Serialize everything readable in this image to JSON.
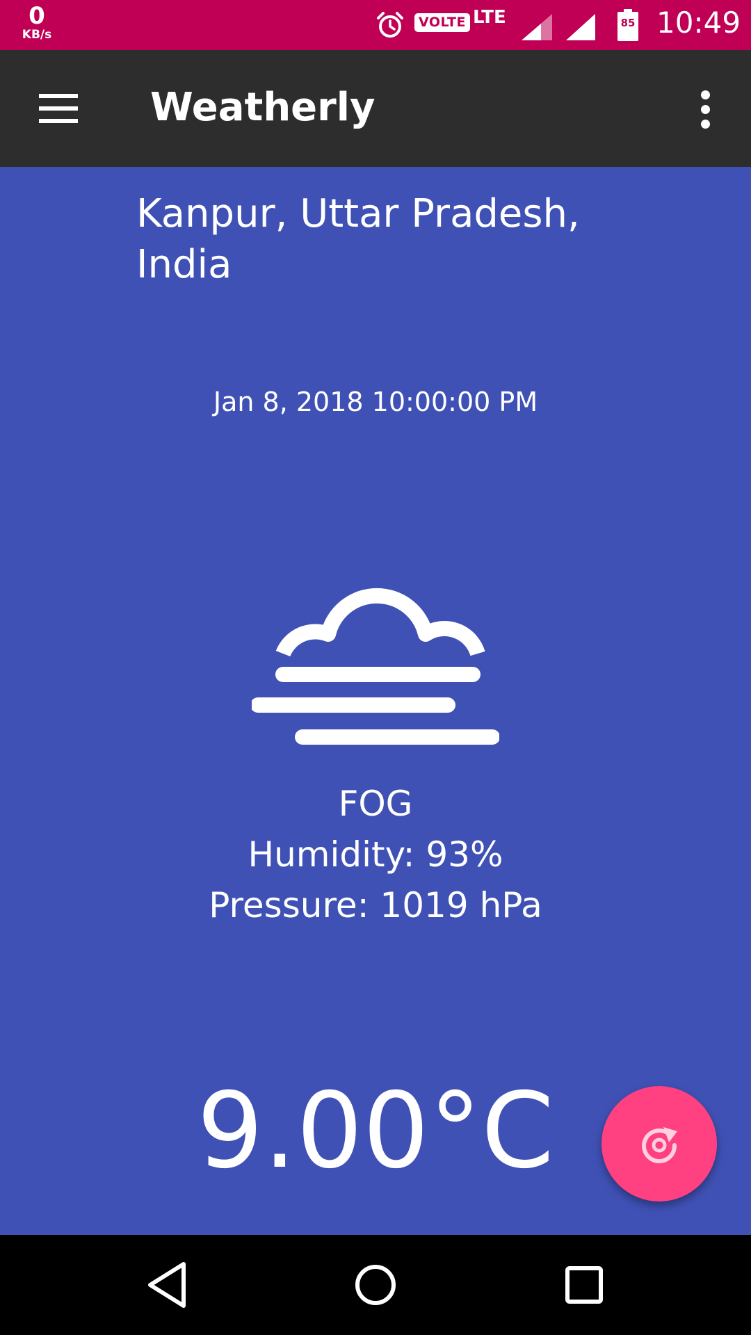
{
  "status_bar": {
    "net_speed_value": "0",
    "net_speed_unit": "KB/s",
    "volte_label": "VOLTE",
    "network_type": "LTE",
    "battery_level": "85",
    "time": "10:49",
    "icons": [
      "alarm-icon",
      "signal-icon",
      "battery-icon"
    ]
  },
  "app_bar": {
    "title": "Weatherly",
    "icons": [
      "menu-icon",
      "more-vert-icon"
    ]
  },
  "weather": {
    "location": "Kanpur, Uttar Pradesh, India",
    "datetime": "Jan 8, 2018 10:00:00 PM",
    "icon": "fog-icon",
    "condition": "FOG",
    "humidity": "Humidity: 93%",
    "pressure": "Pressure: 1019 hPa",
    "temperature": "9.00°C"
  },
  "fab": {
    "icon": "refresh-icon"
  },
  "nav_bar": {
    "icons": [
      "back-icon",
      "home-icon",
      "recents-icon"
    ]
  },
  "colors": {
    "background": "#3f51b5",
    "status_bar": "#bf0055",
    "app_bar": "#2d2d2d",
    "accent": "#ff4081"
  }
}
